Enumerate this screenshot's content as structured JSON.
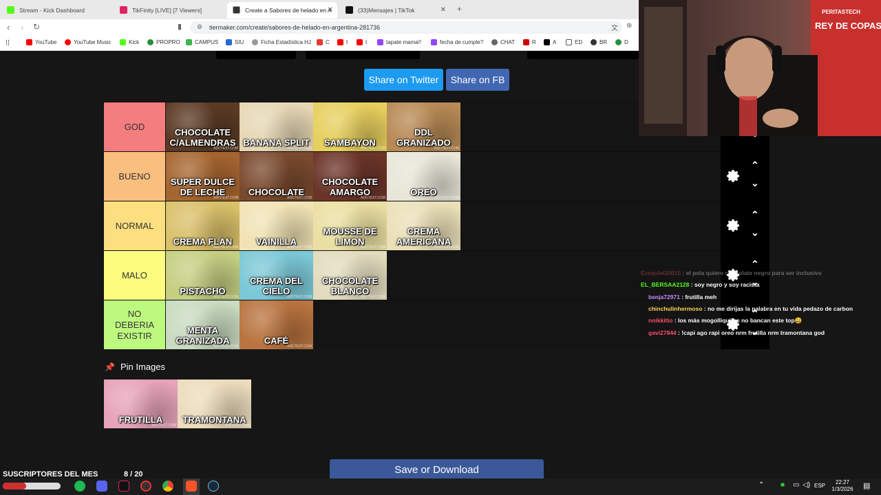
{
  "tabs": [
    {
      "title": "Stream - Kick Dashboard",
      "color": "#53fc18"
    },
    {
      "title": "TikFinity [LIVE] [7 Viewers]",
      "color": "#e0245e"
    },
    {
      "title": "Create a Sabores de helado en A",
      "color": "#333333"
    },
    {
      "title": "(33)Mensajes | TikTok",
      "color": "#111111"
    }
  ],
  "url": "tiermaker.com/create/sabores-de-helado-en-argentina-281736",
  "bookmarks": [
    "YouTube",
    "YouTube Music",
    "Kick",
    "PROPRO",
    "CAMPUS",
    "SIU",
    "Ficha Estadística HJ",
    "C",
    "t",
    "t",
    "tapate mama!!",
    "fecha de cumple?",
    "CHAT",
    "R",
    "A",
    "ED",
    "BR",
    "D"
  ],
  "share": {
    "twitter": "Share on Twitter",
    "fb": "Share on FB"
  },
  "tiers": [
    {
      "label": "GOD",
      "color": "#f47d7d",
      "items": [
        "CHOCOLATE C/ALMENDRAS",
        "BANANA SPLIT",
        "SAMBAYON",
        "DDL GRANIZADO"
      ]
    },
    {
      "label": "BUENO",
      "color": "#f9bf7f",
      "items": [
        "SUPER DULCE DE LECHE",
        "CHOCOLATE",
        "CHOCOLATE AMARGO",
        "OREO"
      ]
    },
    {
      "label": "NORMAL",
      "color": "#fcdf7f",
      "items": [
        "CREMA FLAN",
        "VAINILLA",
        "MOUSSE DE LIMON",
        "CREMA AMERICANA"
      ]
    },
    {
      "label": "MALO",
      "color": "#fcfd7f",
      "items": [
        "PISTACHO",
        "CREMA DEL CIELO",
        "CHOCOLATE BLANCO"
      ]
    },
    {
      "label": "NO DEBERIA EXISTIR",
      "color": "#bef97f",
      "items": [
        "MENTA GRANIZADA",
        "CAFÉ"
      ]
    }
  ],
  "item_colors": {
    "CHOCOLATE C/ALMENDRAS": "#5a3a24",
    "BANANA SPLIT": "#e6d7b4",
    "SAMBAYON": "#e7cf5e",
    "DDL GRANIZADO": "#b88a55",
    "SUPER DULCE DE LECHE": "#a5652f",
    "CHOCOLATE": "#7a4a2e",
    "CHOCOLATE AMARGO": "#6b3428",
    "OREO": "#e8e6d8",
    "CREMA FLAN": "#d9c06a",
    "VAINILLA": "#f1e3b5",
    "MOUSSE DE LIMON": "#eadfa2",
    "CREMA AMERICANA": "#eae0b8",
    "PISTACHO": "#c5cf82",
    "CREMA DEL CIELO": "#7bc8d6",
    "CHOCOLATE BLANCO": "#e2dbbe",
    "MENTA GRANIZADA": "#c9dbc0",
    "CAFÉ": "#b9743f",
    "FRUTILLA": "#e6a3b9",
    "TRAMONTANA": "#ecdcbd"
  },
  "watermark": "ADDTEXT.COM",
  "pin": {
    "title": "Pin Images",
    "items": [
      "FRUTILLA",
      "TRAMONTANA"
    ]
  },
  "save_button": "Save or Download",
  "chat": [
    {
      "user": "Ezequiel20015",
      "user_color": "#ff5f5f",
      "msg": "el pela quiere chocolate negro para ser inclusivo",
      "faded": true
    },
    {
      "user": "EL_BERSAA2128",
      "user_color": "#53fc18",
      "msg": "soy negro y soy racista",
      "faded": false
    },
    {
      "user": "benja72971",
      "user_color": "#c48cff",
      "msg": "frutilla meh",
      "faded": false
    },
    {
      "user": "chinchulinhermoso",
      "user_color": "#ffd35c",
      "msg": "no me dirijas la palabra en tu vida pedazo de carbon",
      "faded": false
    },
    {
      "user": "nnikkitto",
      "user_color": "#ff4d6d",
      "msg": "los más mogolliquitos no bancan este top😄",
      "faded": false
    },
    {
      "user": "gavi27844",
      "user_color": "#ff4d6d",
      "msg": "!capi ago rapi oreo nrm frutilla nrm tramontana god",
      "faded": false
    }
  ],
  "overlay": {
    "subs_label": "SUSCRIPTORES DEL MES",
    "subs_count": "8 / 20"
  },
  "taskbar": {
    "lang": "ESP",
    "time": "22:27",
    "date": "1/3/2026"
  }
}
